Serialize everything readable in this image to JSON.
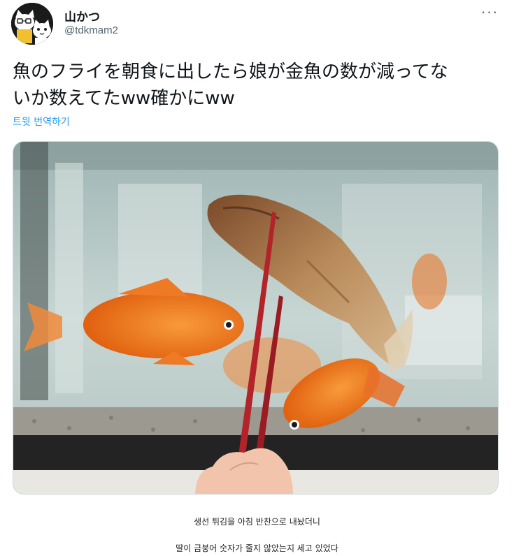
{
  "tweet": {
    "display_name": "山かつ",
    "handle": "@tdkmam2",
    "text_line1": "魚のフライを朝食に出したら娘が金魚の数が減ってな",
    "text_line2": "いか数えてたww確かにww",
    "translate_label": "트윗 번역하기",
    "more_icon": "more-horizontal-icon"
  },
  "caption": {
    "line1": "생선 튀김을 아침 반찬으로 내놨더니",
    "line2": "딸이 금붕어 숫자가 줄지 않았는지 세고 있었다"
  },
  "colors": {
    "link": "#1d9bf0",
    "secondary_text": "#536471",
    "goldfish": "#f07a1a"
  }
}
